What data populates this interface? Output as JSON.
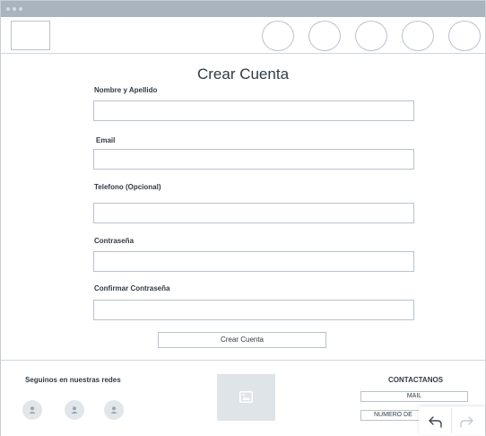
{
  "form": {
    "title": "Crear Cuenta",
    "fields": [
      {
        "label": "Nombre y Apellido",
        "value": "",
        "placeholder": ""
      },
      {
        "label": "Email",
        "value": "",
        "placeholder": ""
      },
      {
        "label": "Telefono (Opcional)",
        "value": "",
        "placeholder": ""
      },
      {
        "label": "Contraseña",
        "value": "",
        "placeholder": ""
      },
      {
        "label": "Confirmar Contraseña",
        "value": "",
        "placeholder": ""
      }
    ],
    "submit_label": "Crear Cuenta"
  },
  "footer": {
    "social_title": "Seguinos en nuestras redes",
    "social_icons": [
      "user-icon",
      "user-icon",
      "user-icon"
    ],
    "image_icon": "image-icon",
    "contact_title": "CONTACTANOS",
    "contact_buttons": [
      "MAIL",
      "NUMERO DE"
    ]
  },
  "toolbar": {
    "undo_icon": "undo-icon",
    "redo_icon": "redo-icon"
  },
  "colors": {
    "titlebar": "#aab4be",
    "border": "#b9c2cb",
    "text": "#2f3a45",
    "placeholder_fill": "#dfe4e9"
  }
}
